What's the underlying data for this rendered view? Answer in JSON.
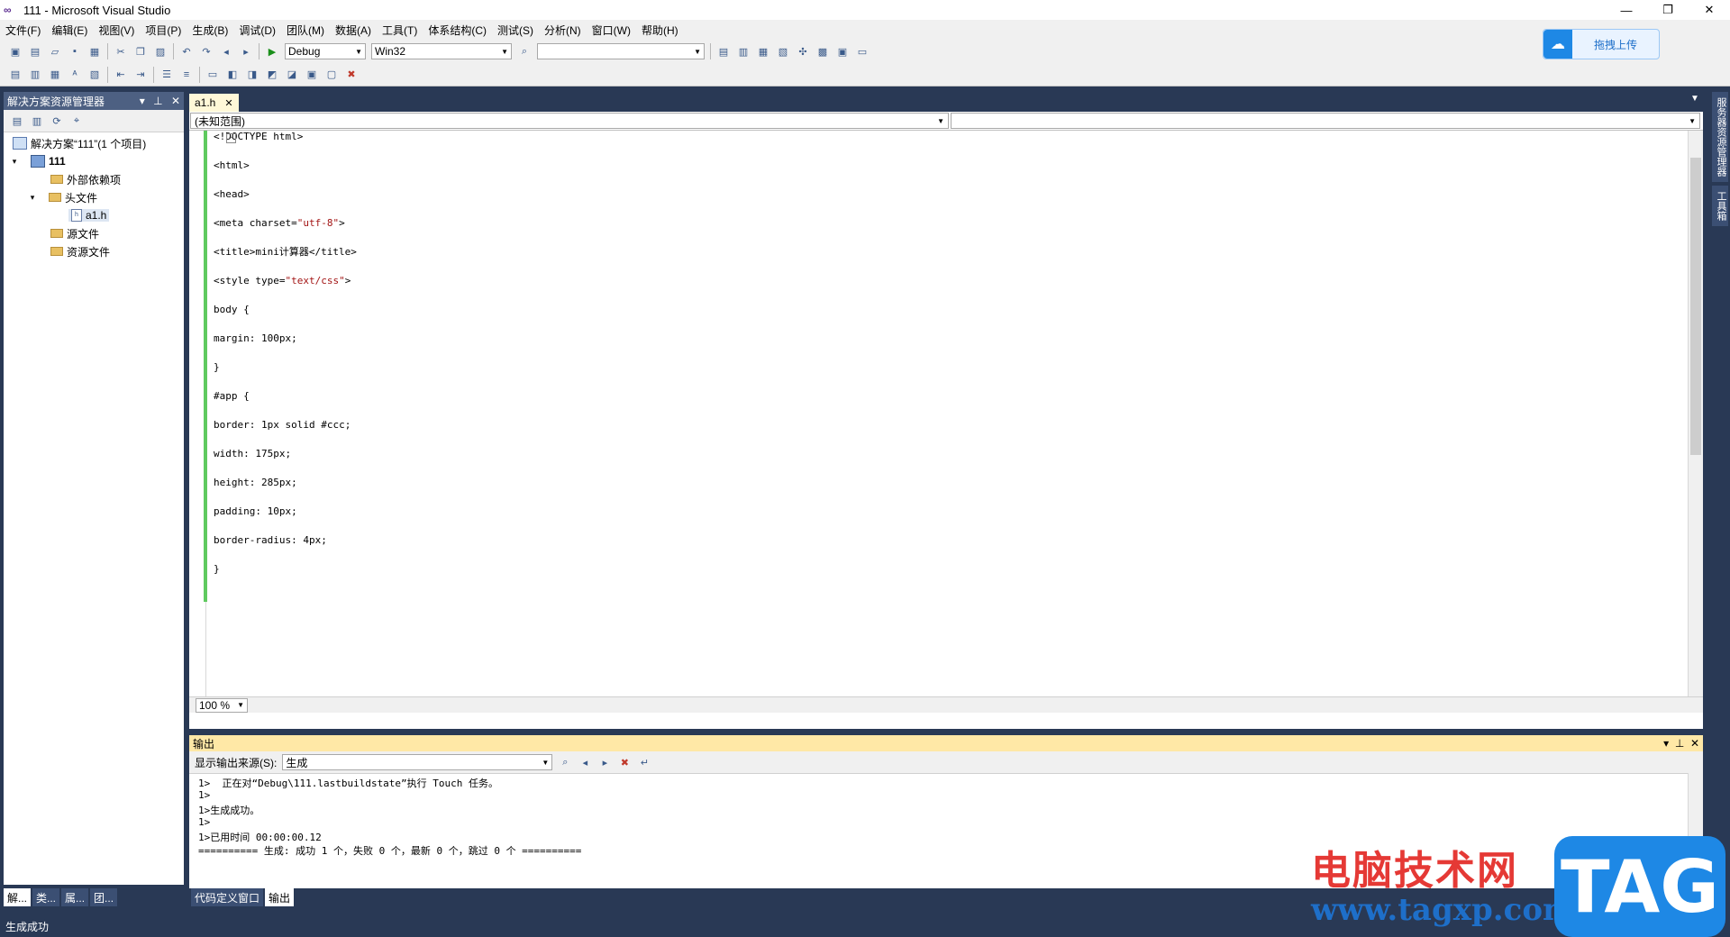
{
  "window": {
    "title": "111 - Microsoft Visual Studio",
    "logo_glyph": "∞"
  },
  "window_controls": {
    "minimize": "—",
    "maximize": "❐",
    "close": "✕"
  },
  "menu": [
    "文件(F)",
    "编辑(E)",
    "视图(V)",
    "项目(P)",
    "生成(B)",
    "调试(D)",
    "团队(M)",
    "数据(A)",
    "工具(T)",
    "体系结构(C)",
    "测试(S)",
    "分析(N)",
    "窗口(W)",
    "帮助(H)"
  ],
  "toolbar": {
    "config": "Debug",
    "platform": "Win32",
    "find_value": ""
  },
  "cloud_button": {
    "label": "拖拽上传",
    "icon": "cloud-icon"
  },
  "solution_explorer": {
    "title": "解决方案资源管理器",
    "items": [
      {
        "label": "解决方案“111”(1 个项目)",
        "level": 0,
        "expander": "",
        "icon": "solution"
      },
      {
        "label": "111",
        "level": 0,
        "expander": "▾",
        "icon": "project"
      },
      {
        "label": "外部依赖项",
        "level": 2,
        "expander": "",
        "icon": "folder"
      },
      {
        "label": "头文件",
        "level": 1,
        "expander": "▾",
        "icon": "folder"
      },
      {
        "label": "a1.h",
        "level": 3,
        "expander": "",
        "icon": "file",
        "selected": true
      },
      {
        "label": "源文件",
        "level": 2,
        "expander": "",
        "icon": "folder"
      },
      {
        "label": "资源文件",
        "level": 2,
        "expander": "",
        "icon": "folder"
      }
    ]
  },
  "left_bottom_tabs": [
    "解...",
    "类...",
    "属...",
    "团..."
  ],
  "document_tab": {
    "label": "a1.h",
    "close": "✕"
  },
  "scope": {
    "left": "(未知范围)",
    "right": ""
  },
  "code": [
    {
      "parts": [
        {
          "t": "<!DOCTYPE html>"
        }
      ]
    },
    {
      "parts": [
        {
          "t": "<html>"
        }
      ]
    },
    {
      "parts": [
        {
          "t": "<head>"
        }
      ]
    },
    {
      "parts": [
        {
          "t": "<meta charset="
        },
        {
          "t": "\"utf-8\"",
          "s": 1
        },
        {
          "t": ">"
        }
      ]
    },
    {
      "parts": [
        {
          "t": "<title>mini计算器</title>"
        }
      ]
    },
    {
      "parts": [
        {
          "t": "<style type="
        },
        {
          "t": "\"text/css\"",
          "s": 1
        },
        {
          "t": ">"
        }
      ]
    },
    {
      "parts": [
        {
          "t": "body {"
        }
      ]
    },
    {
      "parts": [
        {
          "t": "margin: 100px;"
        }
      ]
    },
    {
      "parts": [
        {
          "t": "}"
        }
      ]
    },
    {
      "parts": [
        {
          "t": "#app {"
        }
      ]
    },
    {
      "parts": [
        {
          "t": "border: 1px solid #ccc;"
        }
      ]
    },
    {
      "parts": [
        {
          "t": "width: 175px;"
        }
      ]
    },
    {
      "parts": [
        {
          "t": "height: 285px;"
        }
      ]
    },
    {
      "parts": [
        {
          "t": "padding: 10px;"
        }
      ]
    },
    {
      "parts": [
        {
          "t": "border-radius: 4px;"
        }
      ]
    },
    {
      "parts": [
        {
          "t": "}"
        }
      ]
    }
  ],
  "zoom": "100 %",
  "output": {
    "title": "输出",
    "source_label": "显示输出来源(S):",
    "source_value": "生成",
    "lines": [
      "1>  正在对“Debug\\111.lastbuildstate”执行 Touch 任务。",
      "1>",
      "1>生成成功。",
      "1>",
      "1>已用时间 00:00:00.12",
      "========== 生成: 成功 1 个，失败 0 个，最新 0 个，跳过 0 个 =========="
    ]
  },
  "bottom_tabs": [
    "代码定义窗口",
    "输出"
  ],
  "right_rail": [
    "服务器资源管理器",
    "工具箱"
  ],
  "status": "生成成功",
  "watermark": {
    "line1": "电脑技术网",
    "line2": "www.tagxp.com",
    "badge": "TAG"
  }
}
